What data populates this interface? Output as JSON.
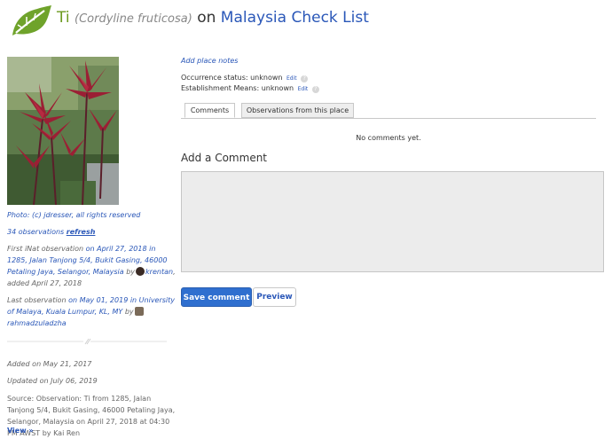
{
  "header": {
    "taxon_common": "Ti",
    "scientific_name": "(Cordyline fruticosa)",
    "on": "on",
    "place_name": "Malaysia Check List",
    "logo_icon": "leaf-logo-icon",
    "logo_color": "#6fa32b"
  },
  "sidebar": {
    "photo_credit": "Photo: (c) jdresser, all rights reserved",
    "observations_count": "34 observations",
    "refresh_label": "refresh",
    "first_obs": {
      "prefix": "First iNat observation",
      "link": "on April 27, 2018 in 1285, Jalan Tanjong 5/4, Bukit Gasing, 46000 Petaling Jaya, Selangor, Malaysia",
      "by": "by",
      "user": "krentan",
      "suffix": ", added April 27, 2018"
    },
    "last_obs": {
      "prefix": "Last observation",
      "link": "on May 01, 2019 in University of Malaya, Kuala Lumpur, KL, MY",
      "by": "by",
      "user": "rahmadzuladzha"
    },
    "added": "Added on May 21, 2017",
    "updated": "Updated on July 06, 2019",
    "source": "Source: Observation: Ti from 1285, Jalan Tanjong 5/4, Bukit Gasing, 46000 Petaling Jaya, Selangor, Malaysia on April 27, 2018 at 04:30 PM AWST by Kai Ren",
    "view_link": "View »"
  },
  "main": {
    "add_place_notes": "Add place notes",
    "occurrence_label": "Occurrence status:",
    "occurrence_value": "unknown",
    "establishment_label": "Establishment Means:",
    "establishment_value": "unknown",
    "edit_label": "Edit",
    "help_glyph": "?",
    "tabs": [
      {
        "label": "Comments"
      },
      {
        "label": "Observations from this place"
      }
    ],
    "no_comments": "No comments yet.",
    "add_comment_heading": "Add a Comment",
    "comment_value": "",
    "save_label": "Save comment",
    "preview_label": "Preview"
  },
  "colors": {
    "accent": "#2f6fcf",
    "link": "#2a57b8",
    "brand_green": "#6c9a1f"
  }
}
